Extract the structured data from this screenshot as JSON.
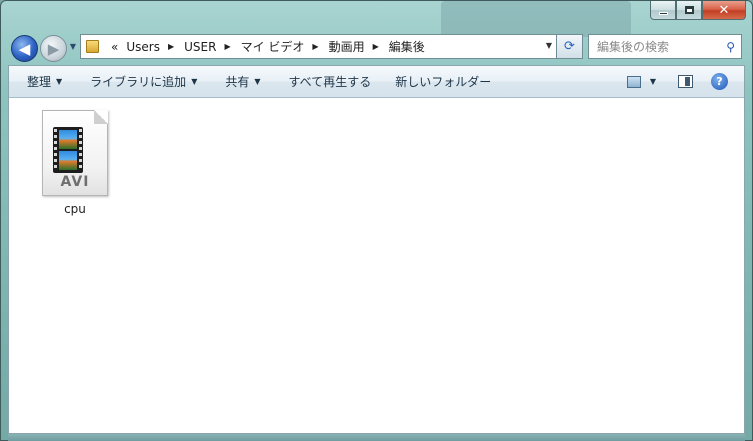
{
  "window": {
    "caption": {
      "minimize_icon": "minimize-icon",
      "maximize_icon": "maximize-icon",
      "close_glyph": "✕"
    }
  },
  "navigation": {
    "back_glyph": "◀",
    "forward_glyph": "▶",
    "history_glyph": "▼",
    "address": {
      "overflow_glyph": "«",
      "crumbs": [
        "Users",
        "USER",
        "マイ ビデオ",
        "動画用",
        "編集後"
      ],
      "separator_glyph": "▶",
      "dropdown_glyph": "▼"
    },
    "refresh_glyph": "⟳",
    "search": {
      "placeholder": "編集後の検索",
      "icon_glyph": "⚲"
    }
  },
  "toolbar": {
    "organize": "整理",
    "add_to_library": "ライブラリに追加",
    "share": "共有",
    "play_all": "すべて再生する",
    "new_folder": "新しいフォルダー",
    "dropdown_glyph": "▼",
    "help_glyph": "?"
  },
  "files": [
    {
      "name": "cpu",
      "type_label": "AVI",
      "icon": "avi-video-file-icon"
    }
  ],
  "colors": {
    "window_frame": "#8ec4c0",
    "toolbar_bg": "#e8f0f6",
    "content_bg": "#ffffff",
    "close_button": "#c13f24",
    "back_button": "#2b62c4"
  }
}
